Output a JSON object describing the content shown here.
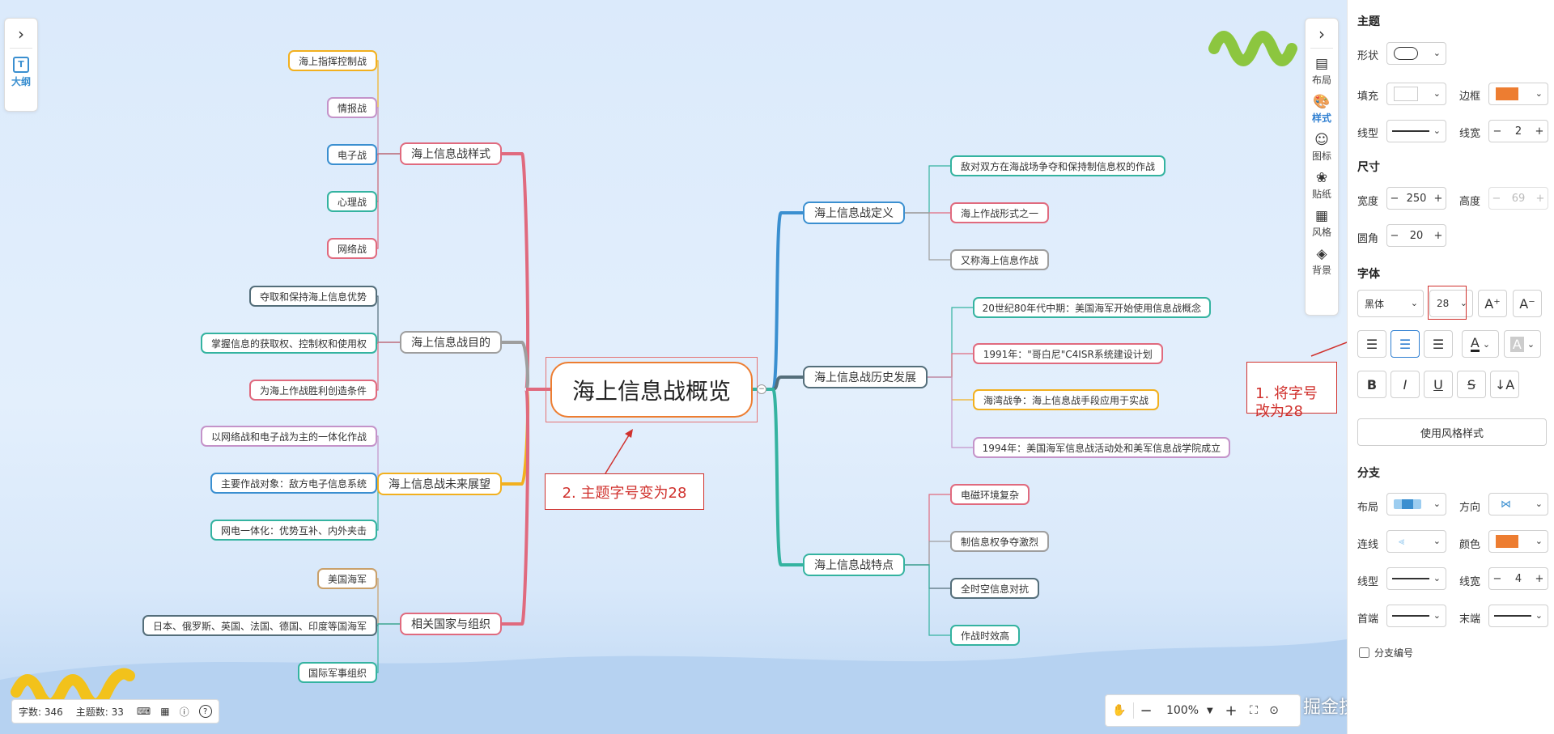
{
  "outline": {
    "icon": "outline-icon",
    "label": "大纲",
    "collapse_icon": "chevron-right-icon"
  },
  "root": {
    "text": "海上信息战概览"
  },
  "left_branches": [
    {
      "title": "海上信息战样式",
      "color": "#e06a7e",
      "children": [
        "海上指挥控制战",
        "情报战",
        "电子战",
        "心理战",
        "网络战"
      ],
      "child_colors": [
        "#f2b01e",
        "#c493c9",
        "#3a8fd0",
        "#34b3a0",
        "#e06a7e"
      ]
    },
    {
      "title": "海上信息战目的",
      "color": "#9e9e9e",
      "children": [
        "夺取和保持海上信息优势",
        "掌握信息的获取权、控制权和使用权",
        "为海上作战胜利创造条件"
      ],
      "child_colors": [
        "#546e7a",
        "#34b3a0",
        "#e06a7e"
      ]
    },
    {
      "title": "海上信息战未来展望",
      "color": "#f2b01e",
      "children": [
        "以网络战和电子战为主的一体化作战",
        "主要作战对象：敌方电子信息系统",
        "网电一体化：优势互补、内外夹击"
      ],
      "child_colors": [
        "#c493c9",
        "#3a8fd0",
        "#34b3a0"
      ]
    },
    {
      "title": "相关国家与组织",
      "color": "#e06a7e",
      "children": [
        "美国海军",
        "日本、俄罗斯、英国、法国、德国、印度等国海军",
        "国际军事组织"
      ],
      "child_colors": [
        "#c9a06a",
        "#546e7a",
        "#34b3a0"
      ]
    }
  ],
  "right_branches": [
    {
      "title": "海上信息战定义",
      "color": "#3a8fd0",
      "children": [
        "敌对双方在海战场争夺和保持制信息权的作战",
        "海上作战形式之一",
        "又称海上信息作战"
      ],
      "child_colors": [
        "#34b3a0",
        "#e06a7e",
        "#9e9e9e"
      ]
    },
    {
      "title": "海上信息战历史发展",
      "color": "#546e7a",
      "children": [
        "20世纪80年代中期：美国海军开始使用信息战概念",
        "1991年：\"哥白尼\"C4ISR系统建设计划",
        "海湾战争：海上信息战手段应用于实战",
        "1994年：美国海军信息战活动处和美军信息战学院成立"
      ],
      "child_colors": [
        "#34b3a0",
        "#e06a7e",
        "#f2b01e",
        "#c493c9"
      ]
    },
    {
      "title": "海上信息战特点",
      "color": "#34b3a0",
      "children": [
        "电磁环境复杂",
        "制信息权争夺激烈",
        "全时空信息对抗",
        "作战时效高"
      ],
      "child_colors": [
        "#e06a7e",
        "#9e9e9e",
        "#546e7a",
        "#34b3a0"
      ]
    }
  ],
  "annotations": {
    "font_size_note": "1. 将字号\n改为28",
    "topic_note": "2. 主题字号变为28"
  },
  "side_tabs": [
    {
      "icon": "layout-icon",
      "label": "布局"
    },
    {
      "icon": "palette-icon",
      "label": "样式",
      "active": true
    },
    {
      "icon": "emoji-icon",
      "label": "图标"
    },
    {
      "icon": "sticker-icon",
      "label": "贴纸"
    },
    {
      "icon": "style-grid-icon",
      "label": "风格"
    },
    {
      "icon": "layers-icon",
      "label": "背景"
    }
  ],
  "props": {
    "topic_title": "主题",
    "shape_label": "形状",
    "fill_label": "填充",
    "border_label": "边框",
    "border_color": "#ed7d31",
    "line_type_label": "线型",
    "line_width_label": "线宽",
    "line_width_value": "2",
    "size_title": "尺寸",
    "width_label": "宽度",
    "width_value": "250",
    "height_label": "高度",
    "height_value": "69",
    "radius_label": "圆角",
    "radius_value": "20",
    "font_title": "字体",
    "font_family": "黑体",
    "font_size": "28",
    "use_style_btn": "使用风格样式",
    "branch_title": "分支",
    "branch_layout_label": "布局",
    "branch_direction_label": "方向",
    "branch_connector_label": "连线",
    "branch_color_label": "颜色",
    "branch_color": "#ed7d31",
    "branch_line_type_label": "线型",
    "branch_line_width_label": "线宽",
    "branch_line_width_value": "4",
    "head_label": "首端",
    "tail_label": "末端",
    "branch_number_label": "分支编号"
  },
  "status": {
    "word_count": "字数: 346",
    "topic_count": "主题数: 33"
  },
  "zoom": {
    "value": "100%"
  },
  "watermark": "掘金技术社区 @ 图形天下"
}
